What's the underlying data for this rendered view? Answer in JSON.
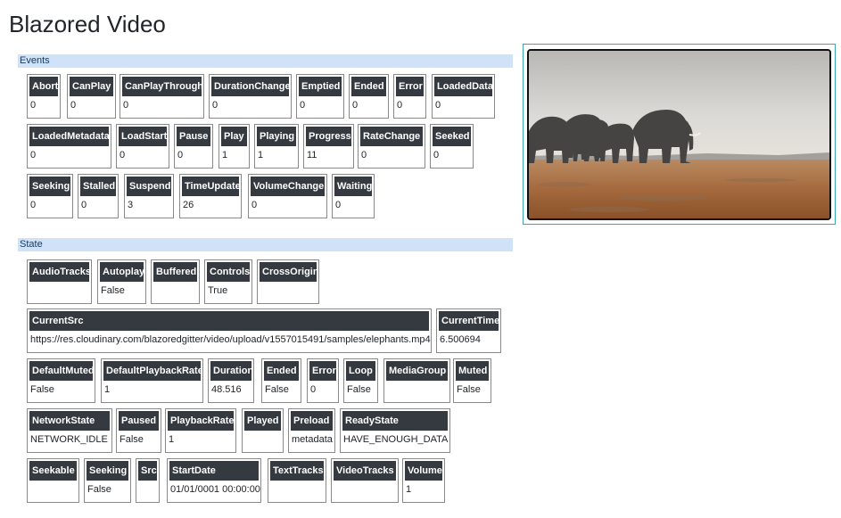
{
  "app": {
    "title": "Blazored Video"
  },
  "events": {
    "section_label": "Events",
    "items": [
      {
        "label": "Abort",
        "value": "0"
      },
      {
        "label": "CanPlay",
        "value": "0"
      },
      {
        "label": "CanPlayThrough",
        "value": "0"
      },
      {
        "label": "DurationChange",
        "value": "0"
      },
      {
        "label": "Emptied",
        "value": "0"
      },
      {
        "label": "Ended",
        "value": "0"
      },
      {
        "label": "Error",
        "value": "0"
      },
      {
        "label": "LoadedData",
        "value": "0"
      },
      {
        "label": "LoadedMetadata",
        "value": "0"
      },
      {
        "label": "LoadStart",
        "value": "0"
      },
      {
        "label": "Pause",
        "value": "0"
      },
      {
        "label": "Play",
        "value": "1"
      },
      {
        "label": "Playing",
        "value": "1"
      },
      {
        "label": "Progress",
        "value": "11"
      },
      {
        "label": "RateChange",
        "value": "0"
      },
      {
        "label": "Seeked",
        "value": "0"
      },
      {
        "label": "Seeking",
        "value": "0"
      },
      {
        "label": "Stalled",
        "value": "0"
      },
      {
        "label": "Suspend",
        "value": "3"
      },
      {
        "label": "TimeUpdate",
        "value": "26"
      },
      {
        "label": "VolumeChange",
        "value": "0"
      },
      {
        "label": "Waiting",
        "value": "0"
      }
    ]
  },
  "state": {
    "section_label": "State",
    "items": [
      {
        "label": "AudioTracks",
        "value": ""
      },
      {
        "label": "Autoplay",
        "value": "False"
      },
      {
        "label": "Buffered",
        "value": ""
      },
      {
        "label": "Controls",
        "value": "True"
      },
      {
        "label": "CrossOrigin",
        "value": ""
      },
      {
        "label": "CurrentSrc",
        "value": "https://res.cloudinary.com/blazoredgitter/video/upload/v1557015491/samples/elephants.mp4"
      },
      {
        "label": "CurrentTime",
        "value": "6.500694"
      },
      {
        "label": "DefaultMuted",
        "value": "False"
      },
      {
        "label": "DefaultPlaybackRate",
        "value": "1"
      },
      {
        "label": "Duration",
        "value": "48.516"
      },
      {
        "label": "Ended",
        "value": "False"
      },
      {
        "label": "Error",
        "value": "0"
      },
      {
        "label": "Loop",
        "value": "False"
      },
      {
        "label": "MediaGroup",
        "value": ""
      },
      {
        "label": "Muted",
        "value": "False"
      },
      {
        "label": "NetworkState",
        "value": "NETWORK_IDLE"
      },
      {
        "label": "Paused",
        "value": "False"
      },
      {
        "label": "PlaybackRate",
        "value": "1"
      },
      {
        "label": "Played",
        "value": ""
      },
      {
        "label": "Preload",
        "value": "metadata"
      },
      {
        "label": "ReadyState",
        "value": "HAVE_ENOUGH_DATA"
      },
      {
        "label": "Seekable",
        "value": ""
      },
      {
        "label": "Seeking",
        "value": "False"
      },
      {
        "label": "Src",
        "value": ""
      },
      {
        "label": "StartDate",
        "value": "01/01/0001 00:00:00"
      },
      {
        "label": "TextTracks",
        "value": ""
      },
      {
        "label": "VideoTracks",
        "value": ""
      },
      {
        "label": "Volume",
        "value": "1"
      }
    ]
  },
  "video": {
    "content": "elephants-herd-video"
  }
}
